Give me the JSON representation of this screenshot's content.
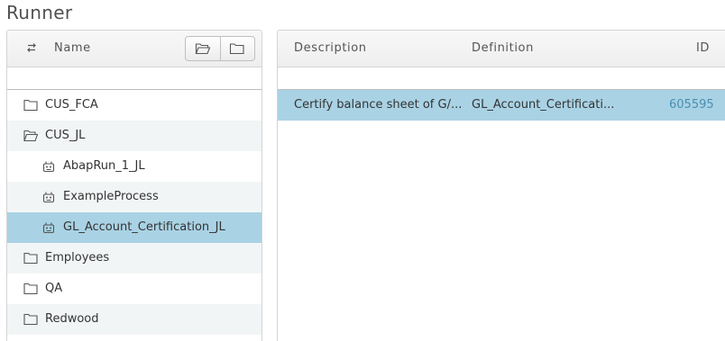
{
  "app": {
    "title": "Runner"
  },
  "tree": {
    "header": {
      "name_label": "Name"
    },
    "items": [
      {
        "label": "CUS_FCA",
        "type": "folder-closed",
        "level": 0
      },
      {
        "label": "CUS_JL",
        "type": "folder-open",
        "level": 0
      },
      {
        "label": "AbapRun_1_JL",
        "type": "process",
        "level": 1
      },
      {
        "label": "ExampleProcess",
        "type": "process",
        "level": 1
      },
      {
        "label": "GL_Account_Certification_JL",
        "type": "process",
        "level": 1,
        "selected": true
      },
      {
        "label": "Employees",
        "type": "folder-closed",
        "level": 0
      },
      {
        "label": "QA",
        "type": "folder-closed",
        "level": 0
      },
      {
        "label": "Redwood",
        "type": "folder-closed",
        "level": 0
      }
    ]
  },
  "details": {
    "columns": {
      "description": "Description",
      "definition": "Definition",
      "id": "ID"
    },
    "rows": [
      {
        "description": "Certify balance sheet of G/...",
        "definition": "GL_Account_Certificati...",
        "id": "605595"
      }
    ]
  },
  "colors": {
    "selected_row": "#a9d2e4",
    "id_text": "#4a8fb1",
    "alt_row": "#f2f5f6"
  }
}
